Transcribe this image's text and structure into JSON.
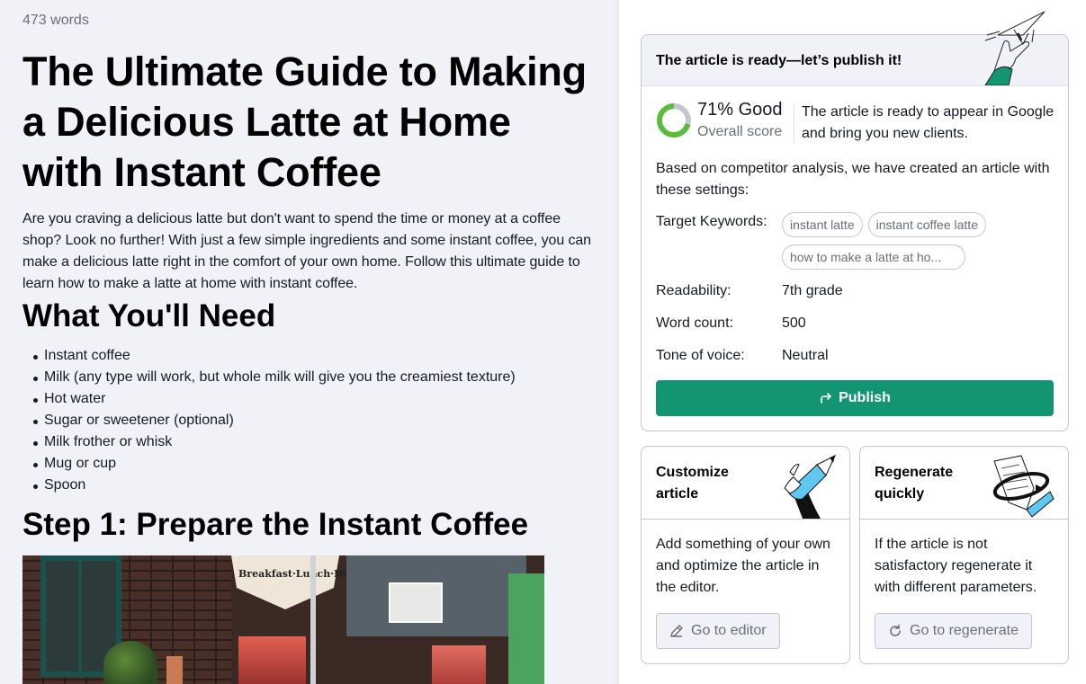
{
  "editor": {
    "word_count": "473 words",
    "title": "The Ultimate Guide to Making a Delicious Latte at Home with Instant Coffee",
    "intro": "Are you craving a delicious latte but don't want to spend the time or money at a coffee shop? Look no further! With just a few simple ingredients and some instant coffee, you can make a delicious latte right in the comfort of your own home. Follow this ultimate guide to learn how to make a latte at home with instant coffee.",
    "section_heading": "What You'll Need",
    "ingredients": [
      "Instant coffee",
      "Milk (any type will work, but whole milk will give you the creamiest texture)",
      "Hot water",
      "Sugar or sweetener (optional)",
      "Milk frother or whisk",
      "Mug or cup",
      "Spoon"
    ],
    "step_heading": "Step 1: Prepare the Instant Coffee",
    "image": {
      "sign_text": "Breakfast·Lunch·Dinner"
    }
  },
  "publish_card": {
    "header": "The article is ready—let’s publish it!",
    "score": {
      "percent": 71,
      "label": "71% Good",
      "sublabel": "Overall score",
      "description": "The article is ready to appear in Google and bring you new clients.",
      "color_good": "#5bbb3a",
      "color_rest": "#c4c7cf"
    },
    "based_text": "Based on competitor analysis, we have created an article with these settings:",
    "keywords_label": "Target Keywords:",
    "keywords": [
      "instant latte",
      "instant coffee latte",
      "how to make a latte at ho..."
    ],
    "properties": [
      {
        "label": "Readability:",
        "value": "7th grade"
      },
      {
        "label": "Word count:",
        "value": "500"
      },
      {
        "label": "Tone of voice:",
        "value": "Neutral"
      }
    ],
    "publish_label": "Publish",
    "accent": "#139574"
  },
  "customize_card": {
    "title": "Customize article",
    "body": "Add something of your own and optimize the article in the editor.",
    "button_label": "Go to editor"
  },
  "regenerate_card": {
    "title": "Regenerate quickly",
    "body": "If the article is not satisfactory regenerate it with different parameters.",
    "button_label": "Go to regenerate"
  }
}
